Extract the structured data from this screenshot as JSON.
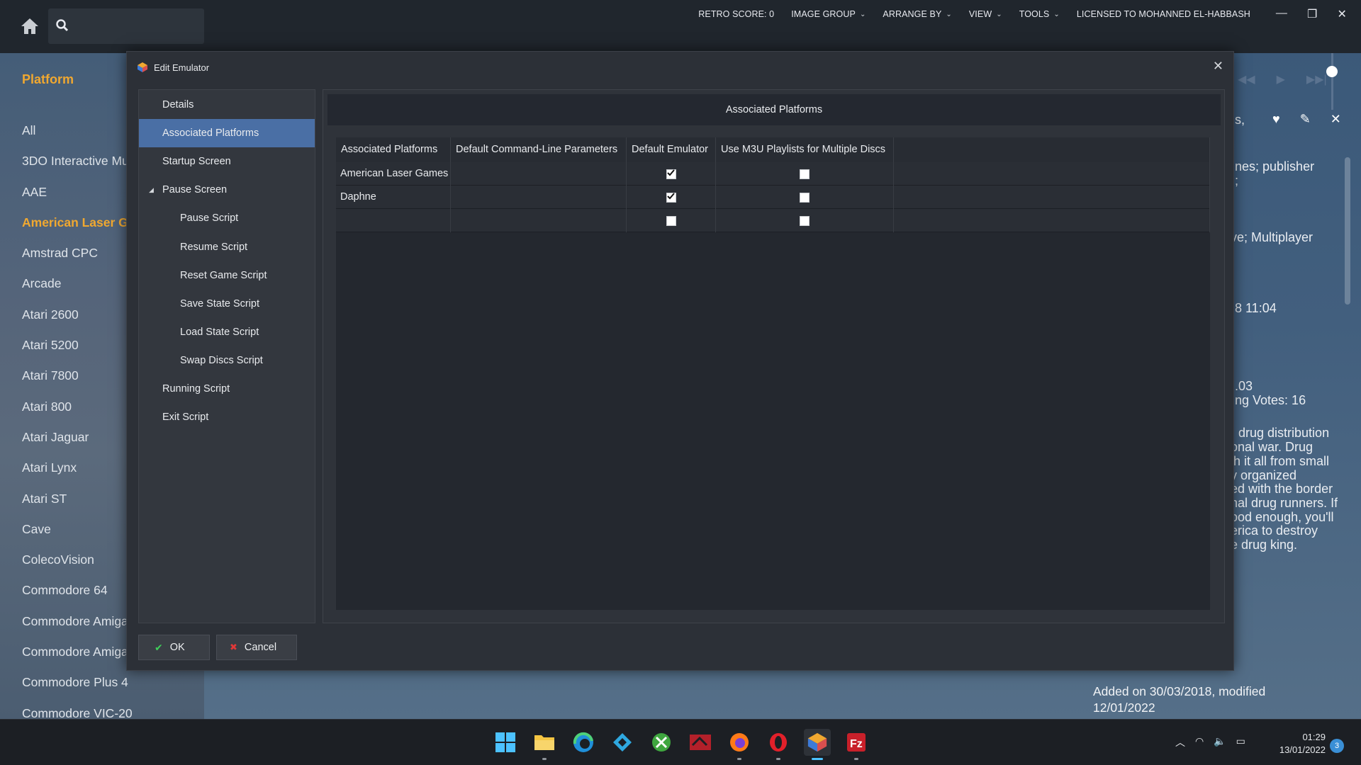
{
  "topbar": {
    "search_placeholder": "",
    "menu": [
      {
        "label": "RETRO SCORE: 0",
        "dropdown": false
      },
      {
        "label": "IMAGE GROUP",
        "dropdown": true
      },
      {
        "label": "ARRANGE BY",
        "dropdown": true
      },
      {
        "label": "VIEW",
        "dropdown": true
      },
      {
        "label": "TOOLS",
        "dropdown": true
      },
      {
        "label": "LICENSED TO MOHANNED EL-HABBASH",
        "dropdown": false
      }
    ]
  },
  "sidebar": {
    "header": "Platform",
    "items": [
      {
        "label": "All"
      },
      {
        "label": "3DO Interactive Mu"
      },
      {
        "label": "AAE"
      },
      {
        "label": "American Laser Ga",
        "active": true
      },
      {
        "label": "Amstrad CPC"
      },
      {
        "label": "Arcade"
      },
      {
        "label": "Atari 2600"
      },
      {
        "label": "Atari 5200"
      },
      {
        "label": "Atari 7800"
      },
      {
        "label": "Atari 800"
      },
      {
        "label": "Atari Jaguar"
      },
      {
        "label": "Atari Lynx"
      },
      {
        "label": "Atari ST"
      },
      {
        "label": "Cave"
      },
      {
        "label": "ColecoVision"
      },
      {
        "label": "Commodore 64"
      },
      {
        "label": "Commodore Amiga"
      },
      {
        "label": "Commodore Amiga"
      },
      {
        "label": "Commodore Plus 4"
      },
      {
        "label": "Commodore VIC-20"
      }
    ]
  },
  "right_panel": {
    "lines": [
      {
        "text": "s,"
      },
      {
        "text": "nes; publisher"
      },
      {
        "text": ";"
      },
      {
        "text": "ve; Multiplayer"
      },
      {
        "text": "8 11:04"
      },
      {
        "text": ".03"
      },
      {
        "text": "ing Votes: 16"
      },
      {
        "text": "l drug distribution"
      },
      {
        "text": "onal war. Drug"
      },
      {
        "text": "h it all from small"
      },
      {
        "text": "y organized"
      },
      {
        "text": "ed with the border"
      },
      {
        "text": "nal drug runners. If"
      },
      {
        "text": "ood enough, you'll"
      },
      {
        "text": "erica to destroy"
      },
      {
        "text": "e drug king."
      }
    ],
    "added_on": "Added on 30/03/2018, modified 12/01/2022"
  },
  "dialog": {
    "title": "Edit Emulator",
    "nav": [
      {
        "label": "Details",
        "level": 1
      },
      {
        "label": "Associated Platforms",
        "level": 1,
        "selected": true
      },
      {
        "label": "Startup Screen",
        "level": 1
      },
      {
        "label": "Pause Screen",
        "level": 1,
        "expanded": true
      },
      {
        "label": "Pause Script",
        "level": 2
      },
      {
        "label": "Resume Script",
        "level": 2
      },
      {
        "label": "Reset Game Script",
        "level": 2
      },
      {
        "label": "Save State Script",
        "level": 2
      },
      {
        "label": "Load State Script",
        "level": 2
      },
      {
        "label": "Swap Discs Script",
        "level": 2
      },
      {
        "label": "Running Script",
        "level": 1
      },
      {
        "label": "Exit Script",
        "level": 1
      }
    ],
    "section_title": "Associated Platforms",
    "table": {
      "columns": [
        "Associated Platforms",
        "Default Command-Line Parameters",
        "Default Emulator",
        "Use M3U Playlists for Multiple Discs"
      ],
      "rows": [
        {
          "platform": "American Laser Games",
          "params": "",
          "default_emulator": true,
          "use_m3u": false
        },
        {
          "platform": "Daphne",
          "params": "",
          "default_emulator": true,
          "use_m3u": false
        },
        {
          "platform": "",
          "params": "",
          "default_emulator": false,
          "use_m3u": false
        }
      ]
    },
    "ok_label": "OK",
    "cancel_label": "Cancel"
  },
  "taskbar": {
    "apps": [
      "start",
      "file-explorer",
      "edge",
      "kodi",
      "xbox",
      "retroarch",
      "firefox",
      "opera",
      "launchbox",
      "filezilla"
    ],
    "time": "01:29",
    "date": "13/01/2022",
    "notifications": "3"
  },
  "colors": {
    "accent": "#f0a830",
    "selection": "#4a6fa5",
    "dialog_bg": "#2c3037"
  }
}
